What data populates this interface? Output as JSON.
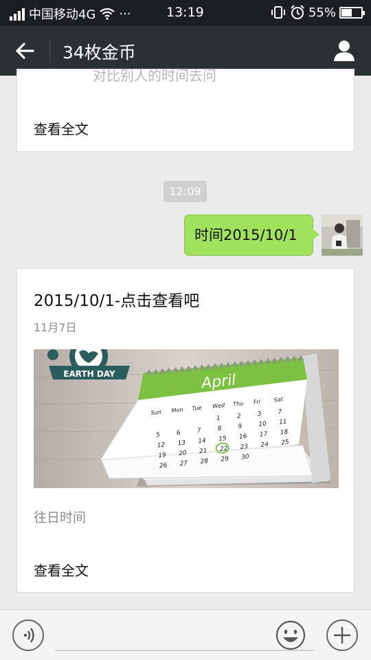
{
  "status_bar": {
    "carrier": "中国移动4G",
    "more": "···",
    "time": "13:19",
    "battery": "55%",
    "battery_level": 0.55
  },
  "header": {
    "title": "34枚金币",
    "back_icon": "back-arrow-icon",
    "profile_icon": "person-icon"
  },
  "messages": {
    "prev_card": {
      "faded_text": "对比别人的时间去问",
      "read_more": "查看全文"
    },
    "timestamp": "12:09",
    "sent_bubble": "时间2015/10/1",
    "article": {
      "title": "2015/10/1-点击查看吧",
      "date": "11月7日",
      "summary": "往日时间",
      "read_more": "查看全文",
      "image": {
        "badge": "EARTH DAY",
        "month": "April",
        "weekdays": [
          "Sun",
          "Mon",
          "Tue",
          "Wed",
          "Thu",
          "Fri",
          "Sat"
        ],
        "days": [
          [
            "",
            "",
            "",
            "1",
            "2",
            "3",
            "7"
          ],
          [
            "5",
            "6",
            "7",
            "8",
            "9",
            "10",
            "11"
          ],
          [
            "12",
            "13",
            "14",
            "15",
            "16",
            "17",
            "18"
          ],
          [
            "19",
            "20",
            "21",
            "22",
            "23",
            "24",
            "25"
          ],
          [
            "26",
            "27",
            "28",
            "29",
            "30",
            "",
            ""
          ]
        ],
        "highlight_day": "22"
      }
    }
  },
  "input_bar": {
    "voice_icon": "voice-icon",
    "emoji_icon": "emoji-icon",
    "plus_icon": "plus-icon"
  },
  "colors": {
    "header_bg": "#2b3033",
    "bubble_green": "#a0e25e",
    "calendar_green": "#7cc142"
  }
}
